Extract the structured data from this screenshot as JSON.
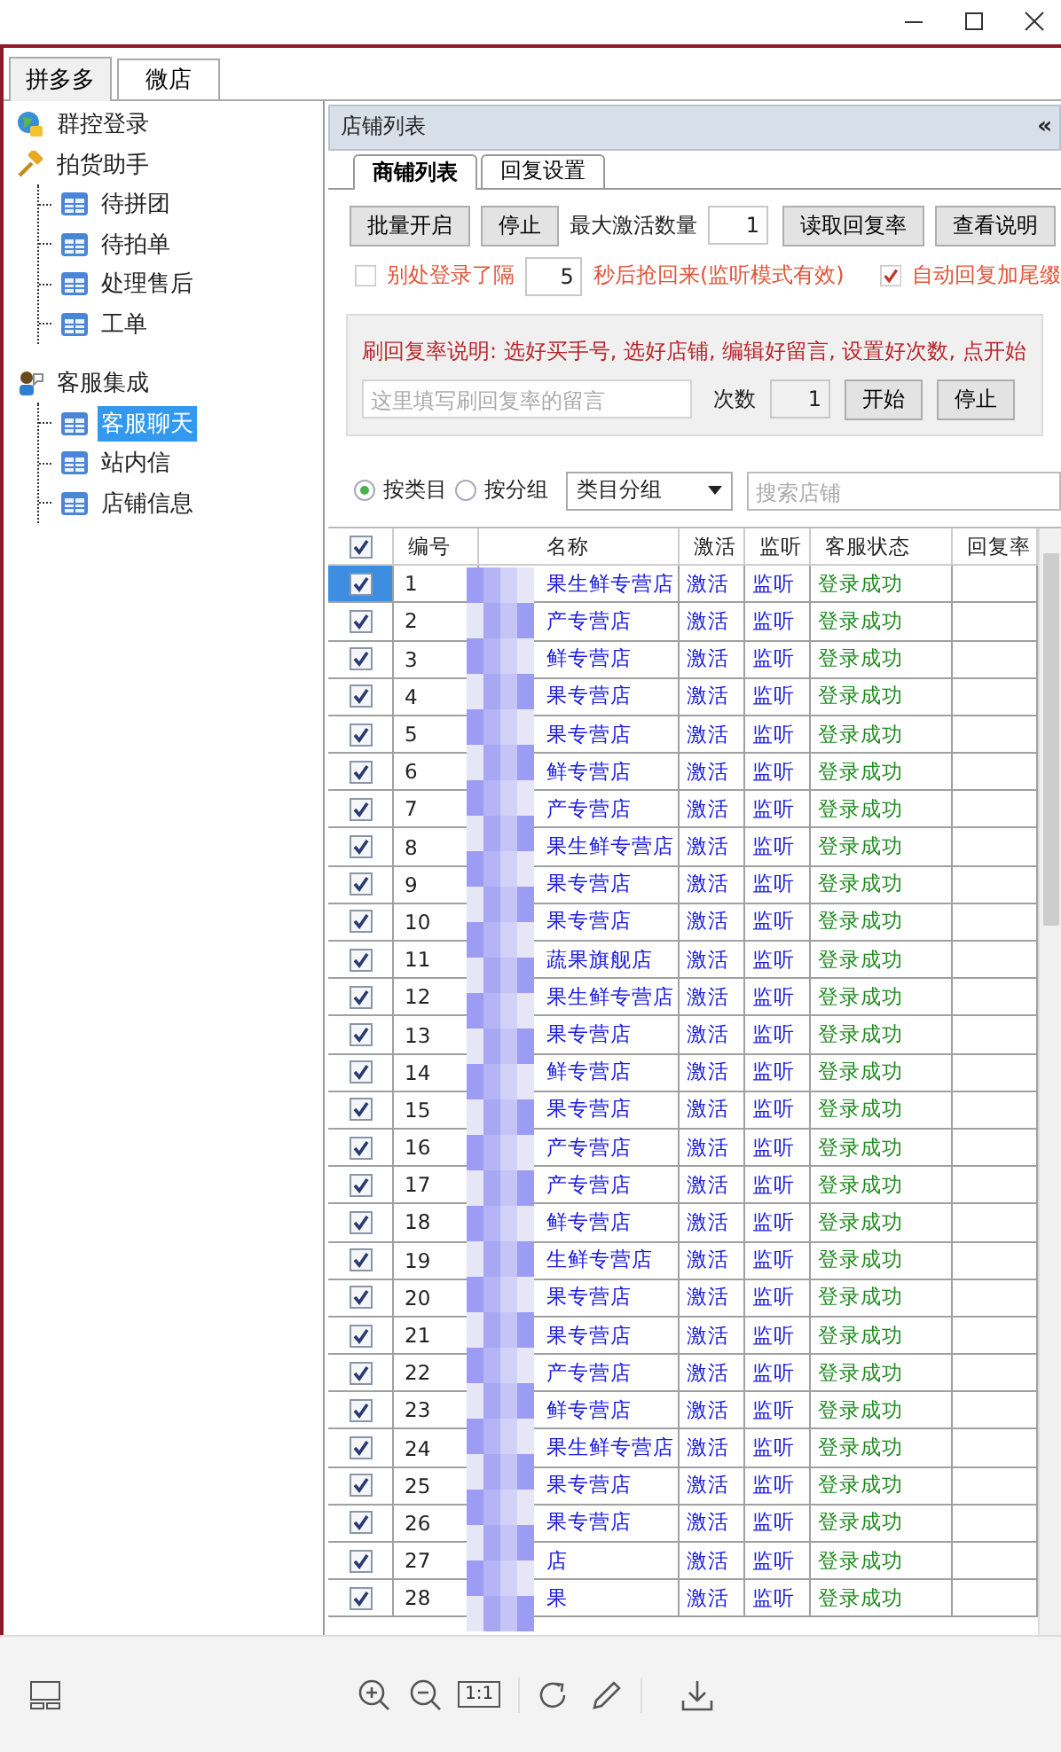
{
  "viewer_toolbar": {
    "actual_size_label": "1:1"
  },
  "app_tabs": [
    {
      "label": "拼多多",
      "selected": true
    },
    {
      "label": "微店",
      "selected": false
    }
  ],
  "sidebar": {
    "items": [
      {
        "label": "群控登录",
        "kind": "globe",
        "selected": false
      },
      {
        "label": "拍货助手",
        "kind": "hammer",
        "selected": false,
        "children": [
          {
            "label": "待拼团",
            "kind": "table",
            "selected": false
          },
          {
            "label": "待拍单",
            "kind": "table",
            "selected": false
          },
          {
            "label": "处理售后",
            "kind": "table",
            "selected": false
          },
          {
            "label": "工单",
            "kind": "table",
            "selected": false
          }
        ]
      },
      {
        "label": "客服集成",
        "kind": "agent",
        "selected": false,
        "children": [
          {
            "label": "客服聊天",
            "kind": "table",
            "selected": true
          },
          {
            "label": "站内信",
            "kind": "table",
            "selected": false
          },
          {
            "label": "店铺信息",
            "kind": "table",
            "selected": false
          }
        ]
      }
    ]
  },
  "panel": {
    "title": "店铺列表",
    "collapse": "«",
    "tabs": [
      {
        "label": "商铺列表",
        "selected": true
      },
      {
        "label": "回复设置",
        "selected": false
      }
    ],
    "toolbar": {
      "batch_start": "批量开启",
      "stop": "停止",
      "max_label": "最大激活数量",
      "max_value": "1",
      "read_rate": "读取回复率",
      "view_help": "查看说明"
    },
    "relogin": {
      "checked": false,
      "label_before": "别处登录了隔",
      "value": "5",
      "label_after": "秒后抢回来(监听模式有效)"
    },
    "auto_suffix": {
      "checked": true,
      "label": "自动回复加尾缀"
    },
    "boost": {
      "note": "刷回复率说明: 选好买手号, 选好店铺,  编辑好留言, 设置好次数, 点开始",
      "placeholder": "这里填写刷回复率的留言",
      "count_label": "次数",
      "count_value": "1",
      "start": "开始",
      "stop": "停止"
    },
    "filter": {
      "radios": [
        {
          "label": "按类目",
          "selected": true
        },
        {
          "label": "按分组",
          "selected": false
        }
      ],
      "dropdown": "类目分组",
      "search_placeholder": "搜索店铺"
    }
  },
  "table": {
    "all_checked": true,
    "columns": [
      "编号",
      "名称",
      "激活",
      "监听",
      "客服状态",
      "回复率"
    ],
    "rows": [
      {
        "checked": true,
        "selected": true,
        "number": "1",
        "name": "果生鲜专营店",
        "activate": "激活",
        "listen": "监听",
        "status": "登录成功"
      },
      {
        "checked": true,
        "selected": false,
        "number": "2",
        "name": "产专营店",
        "activate": "激活",
        "listen": "监听",
        "status": "登录成功"
      },
      {
        "checked": true,
        "selected": false,
        "number": "3",
        "name": "鲜专营店",
        "activate": "激活",
        "listen": "监听",
        "status": "登录成功"
      },
      {
        "checked": true,
        "selected": false,
        "number": "4",
        "name": "果专营店",
        "activate": "激活",
        "listen": "监听",
        "status": "登录成功"
      },
      {
        "checked": true,
        "selected": false,
        "number": "5",
        "name": "果专营店",
        "activate": "激活",
        "listen": "监听",
        "status": "登录成功"
      },
      {
        "checked": true,
        "selected": false,
        "number": "6",
        "name": "鲜专营店",
        "activate": "激活",
        "listen": "监听",
        "status": "登录成功"
      },
      {
        "checked": true,
        "selected": false,
        "number": "7",
        "name": "产专营店",
        "activate": "激活",
        "listen": "监听",
        "status": "登录成功"
      },
      {
        "checked": true,
        "selected": false,
        "number": "8",
        "name": "果生鲜专营店",
        "activate": "激活",
        "listen": "监听",
        "status": "登录成功"
      },
      {
        "checked": true,
        "selected": false,
        "number": "9",
        "name": "果专营店",
        "activate": "激活",
        "listen": "监听",
        "status": "登录成功"
      },
      {
        "checked": true,
        "selected": false,
        "number": "10",
        "name": "果专营店",
        "activate": "激活",
        "listen": "监听",
        "status": "登录成功"
      },
      {
        "checked": true,
        "selected": false,
        "number": "11",
        "name": "蔬果旗舰店",
        "activate": "激活",
        "listen": "监听",
        "status": "登录成功"
      },
      {
        "checked": true,
        "selected": false,
        "number": "12",
        "name": "果生鲜专营店",
        "activate": "激活",
        "listen": "监听",
        "status": "登录成功"
      },
      {
        "checked": true,
        "selected": false,
        "number": "13",
        "name": "果专营店",
        "activate": "激活",
        "listen": "监听",
        "status": "登录成功"
      },
      {
        "checked": true,
        "selected": false,
        "number": "14",
        "name": "鲜专营店",
        "activate": "激活",
        "listen": "监听",
        "status": "登录成功"
      },
      {
        "checked": true,
        "selected": false,
        "number": "15",
        "name": "果专营店",
        "activate": "激活",
        "listen": "监听",
        "status": "登录成功"
      },
      {
        "checked": true,
        "selected": false,
        "number": "16",
        "name": "产专营店",
        "activate": "激活",
        "listen": "监听",
        "status": "登录成功"
      },
      {
        "checked": true,
        "selected": false,
        "number": "17",
        "name": "产专营店",
        "activate": "激活",
        "listen": "监听",
        "status": "登录成功"
      },
      {
        "checked": true,
        "selected": false,
        "number": "18",
        "name": "鲜专营店",
        "activate": "激活",
        "listen": "监听",
        "status": "登录成功"
      },
      {
        "checked": true,
        "selected": false,
        "number": "19",
        "name": "生鲜专营店",
        "activate": "激活",
        "listen": "监听",
        "status": "登录成功"
      },
      {
        "checked": true,
        "selected": false,
        "number": "20",
        "name": "果专营店",
        "activate": "激活",
        "listen": "监听",
        "status": "登录成功"
      },
      {
        "checked": true,
        "selected": false,
        "number": "21",
        "name": "果专营店",
        "activate": "激活",
        "listen": "监听",
        "status": "登录成功"
      },
      {
        "checked": true,
        "selected": false,
        "number": "22",
        "name": "产专营店",
        "activate": "激活",
        "listen": "监听",
        "status": "登录成功"
      },
      {
        "checked": true,
        "selected": false,
        "number": "23",
        "name": "鲜专营店",
        "activate": "激活",
        "listen": "监听",
        "status": "登录成功"
      },
      {
        "checked": true,
        "selected": false,
        "number": "24",
        "name": "果生鲜专营店",
        "activate": "激活",
        "listen": "监听",
        "status": "登录成功"
      },
      {
        "checked": true,
        "selected": false,
        "number": "25",
        "name": "果专营店",
        "activate": "激活",
        "listen": "监听",
        "status": "登录成功"
      },
      {
        "checked": true,
        "selected": false,
        "number": "26",
        "name": "果专营店",
        "activate": "激活",
        "listen": "监听",
        "status": "登录成功"
      },
      {
        "checked": true,
        "selected": false,
        "number": "27",
        "name": "店",
        "activate": "激活",
        "listen": "监听",
        "status": "登录成功"
      },
      {
        "checked": true,
        "selected": false,
        "number": "28",
        "name": "果",
        "activate": "激活",
        "listen": "监听",
        "status": "登录成功"
      }
    ]
  }
}
